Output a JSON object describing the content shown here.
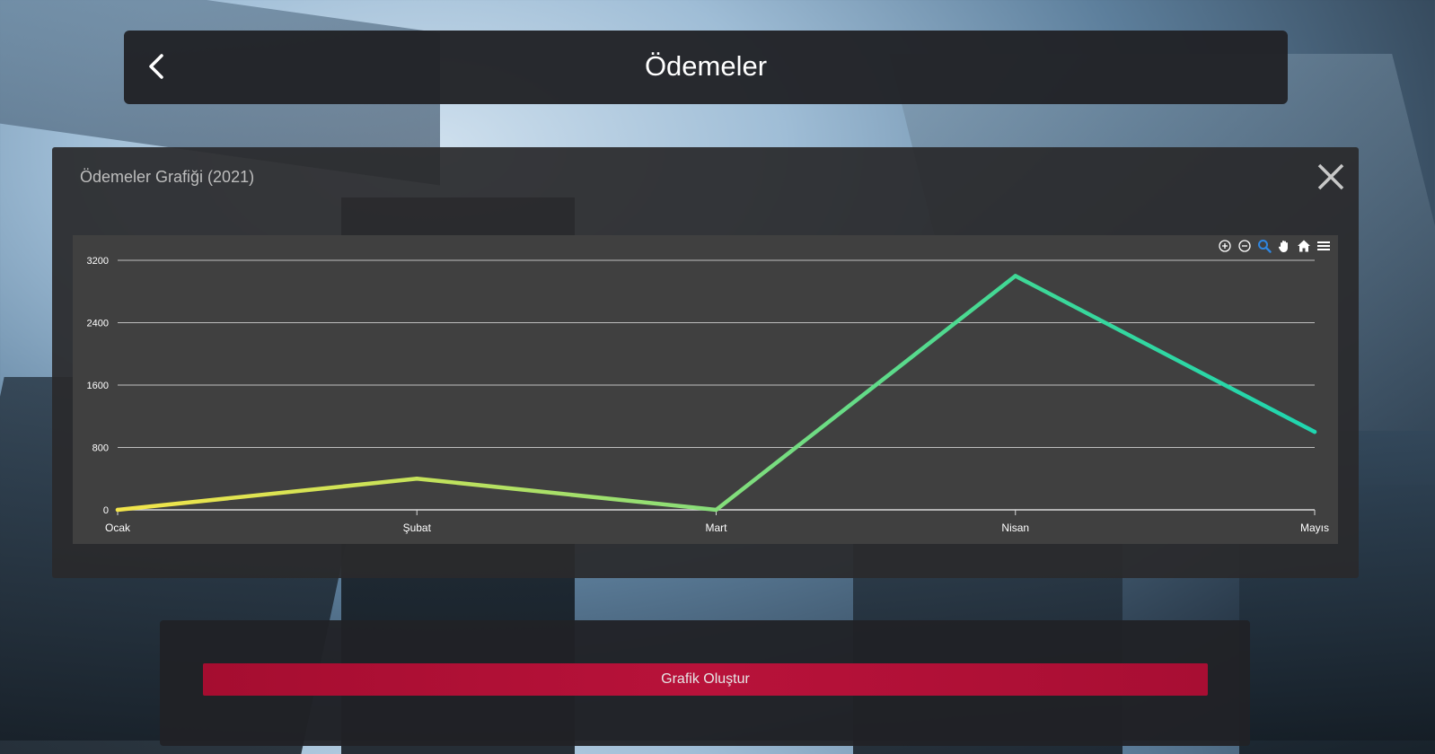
{
  "header": {
    "title": "Ödemeler"
  },
  "panel": {
    "title": "Ödemeler Grafiği (2021)"
  },
  "toolbar": {
    "icons": [
      "zoom-in-icon",
      "zoom-out-icon",
      "selection-zoom-icon",
      "pan-icon",
      "reset-home-icon",
      "menu-icon"
    ]
  },
  "bottom": {
    "button_label": "Grafik Oluştur"
  },
  "colors": {
    "accent": "#b0103a",
    "line_start": "#f2e44a",
    "line_end": "#1fd6b0",
    "selected_tool": "#2f86e0"
  },
  "chart_data": {
    "type": "line",
    "categories": [
      "Ocak",
      "Şubat",
      "Mart",
      "Nisan",
      "Mayıs"
    ],
    "values": [
      0,
      400,
      0,
      3000,
      1000
    ],
    "yticks": [
      0,
      800,
      1600,
      2400,
      3200
    ],
    "ylim": [
      0,
      3200
    ],
    "grid": true,
    "legend": false
  }
}
